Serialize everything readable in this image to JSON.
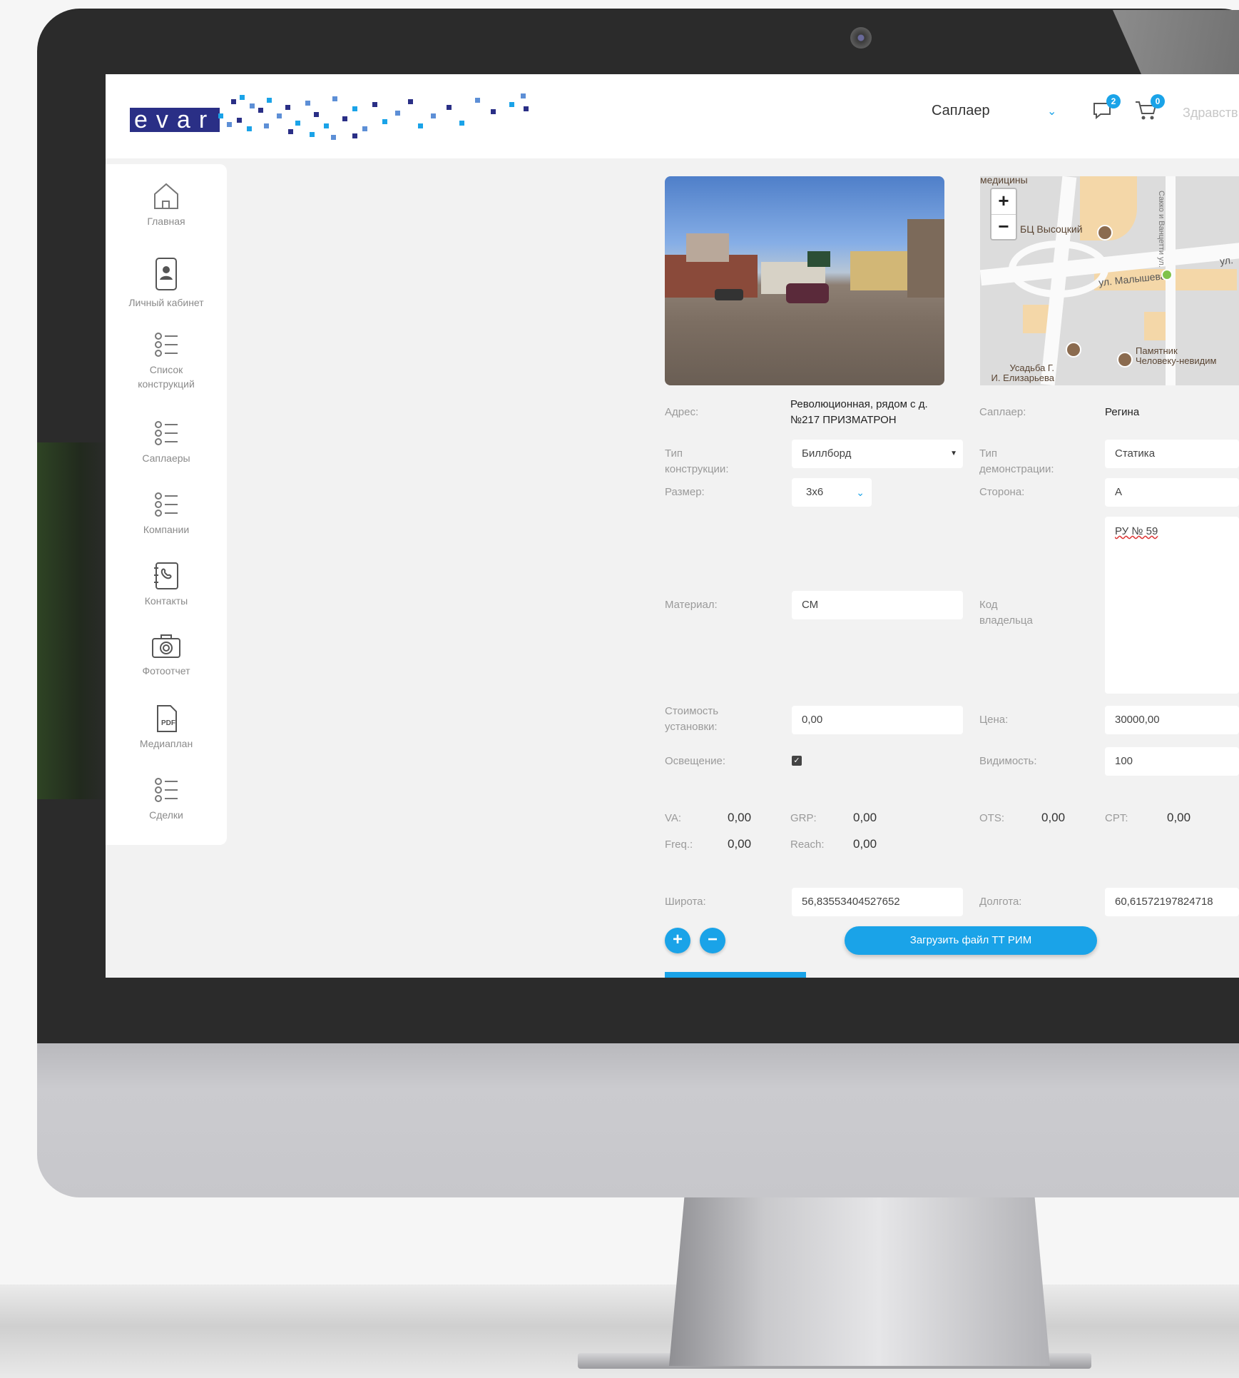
{
  "header": {
    "logo_text": "evar",
    "supplier_select": "Саплаер",
    "messages_badge": "2",
    "cart_badge": "0",
    "greeting": "Здравств"
  },
  "sidebar": {
    "items": [
      {
        "label": "Главная",
        "icon": "home-icon"
      },
      {
        "label": "Личный кабинет",
        "icon": "profile-card-icon"
      },
      {
        "label": "Список конструкций",
        "icon": "checklist-icon"
      },
      {
        "label": "Саплаеры",
        "icon": "checklist-icon"
      },
      {
        "label": "Компании",
        "icon": "checklist-icon"
      },
      {
        "label": "Контакты",
        "icon": "phonebook-icon"
      },
      {
        "label": "Фотоотчет",
        "icon": "camera-icon"
      },
      {
        "label": "Медиаплан",
        "icon": "pdf-icon"
      },
      {
        "label": "Сделки",
        "icon": "checklist-icon"
      }
    ]
  },
  "map": {
    "zoom_in": "+",
    "zoom_out": "−",
    "labels": {
      "top": "медицины",
      "bc": "БЦ Высоцкий",
      "street": "ул. Малышева",
      "street2": "ул.",
      "monument_line1": "Памятник",
      "monument_line2": "Человеку-невидим",
      "estate_line1": "Усадьба Г.",
      "estate_line2": "И. Елизарьева",
      "vertical": "Сакко и Ванцетти ул."
    }
  },
  "form": {
    "address_label": "Адрес:",
    "address_value_line1": "Революционная, рядом с д.",
    "address_value_line2": "№217 ПРИЗМАТРОН",
    "supplier_label": "Саплаер:",
    "supplier_value": "Регина",
    "construction_type_label": "Тип конструкции:",
    "construction_type_value": "Биллборд",
    "demo_type_label": "Тип демонстрации:",
    "demo_type_value": "Статика",
    "size_label": "Размер:",
    "size_value": "3x6",
    "side_label": "Сторона:",
    "side_value": "А",
    "material_label": "Материал:",
    "material_value": "СМ",
    "owner_code_label": "Код владельца",
    "owner_code_value": "РУ № 59",
    "install_cost_label_line1": "Стоимость",
    "install_cost_label_line2": "установки:",
    "install_cost_value": "0,00",
    "price_label": "Цена:",
    "price_value": "30000,00",
    "lighting_label": "Освещение:",
    "lighting_checked": true,
    "visibility_label": "Видимость:",
    "visibility_value": "100",
    "metrics": {
      "va_label": "VA:",
      "va_value": "0,00",
      "grp_label": "GRP:",
      "grp_value": "0,00",
      "ots_label": "OTS:",
      "ots_value": "0,00",
      "cpt_label": "CPT:",
      "cpt_value": "0,00",
      "freq_label": "Freq.:",
      "freq_value": "0,00",
      "reach_label": "Reach:",
      "reach_value": "0,00"
    },
    "latitude_label": "Широта:",
    "latitude_value": "56,83553404527652",
    "longitude_label": "Долгота:",
    "longitude_value": "60,61572197824718",
    "plus_button": "+",
    "minus_button": "−",
    "upload_button": "Загрузить файл ТТ РИМ"
  },
  "colors": {
    "accent": "#1aa3e8",
    "logo_blue": "#2a2f86",
    "bezel": "#2b2b2b"
  }
}
